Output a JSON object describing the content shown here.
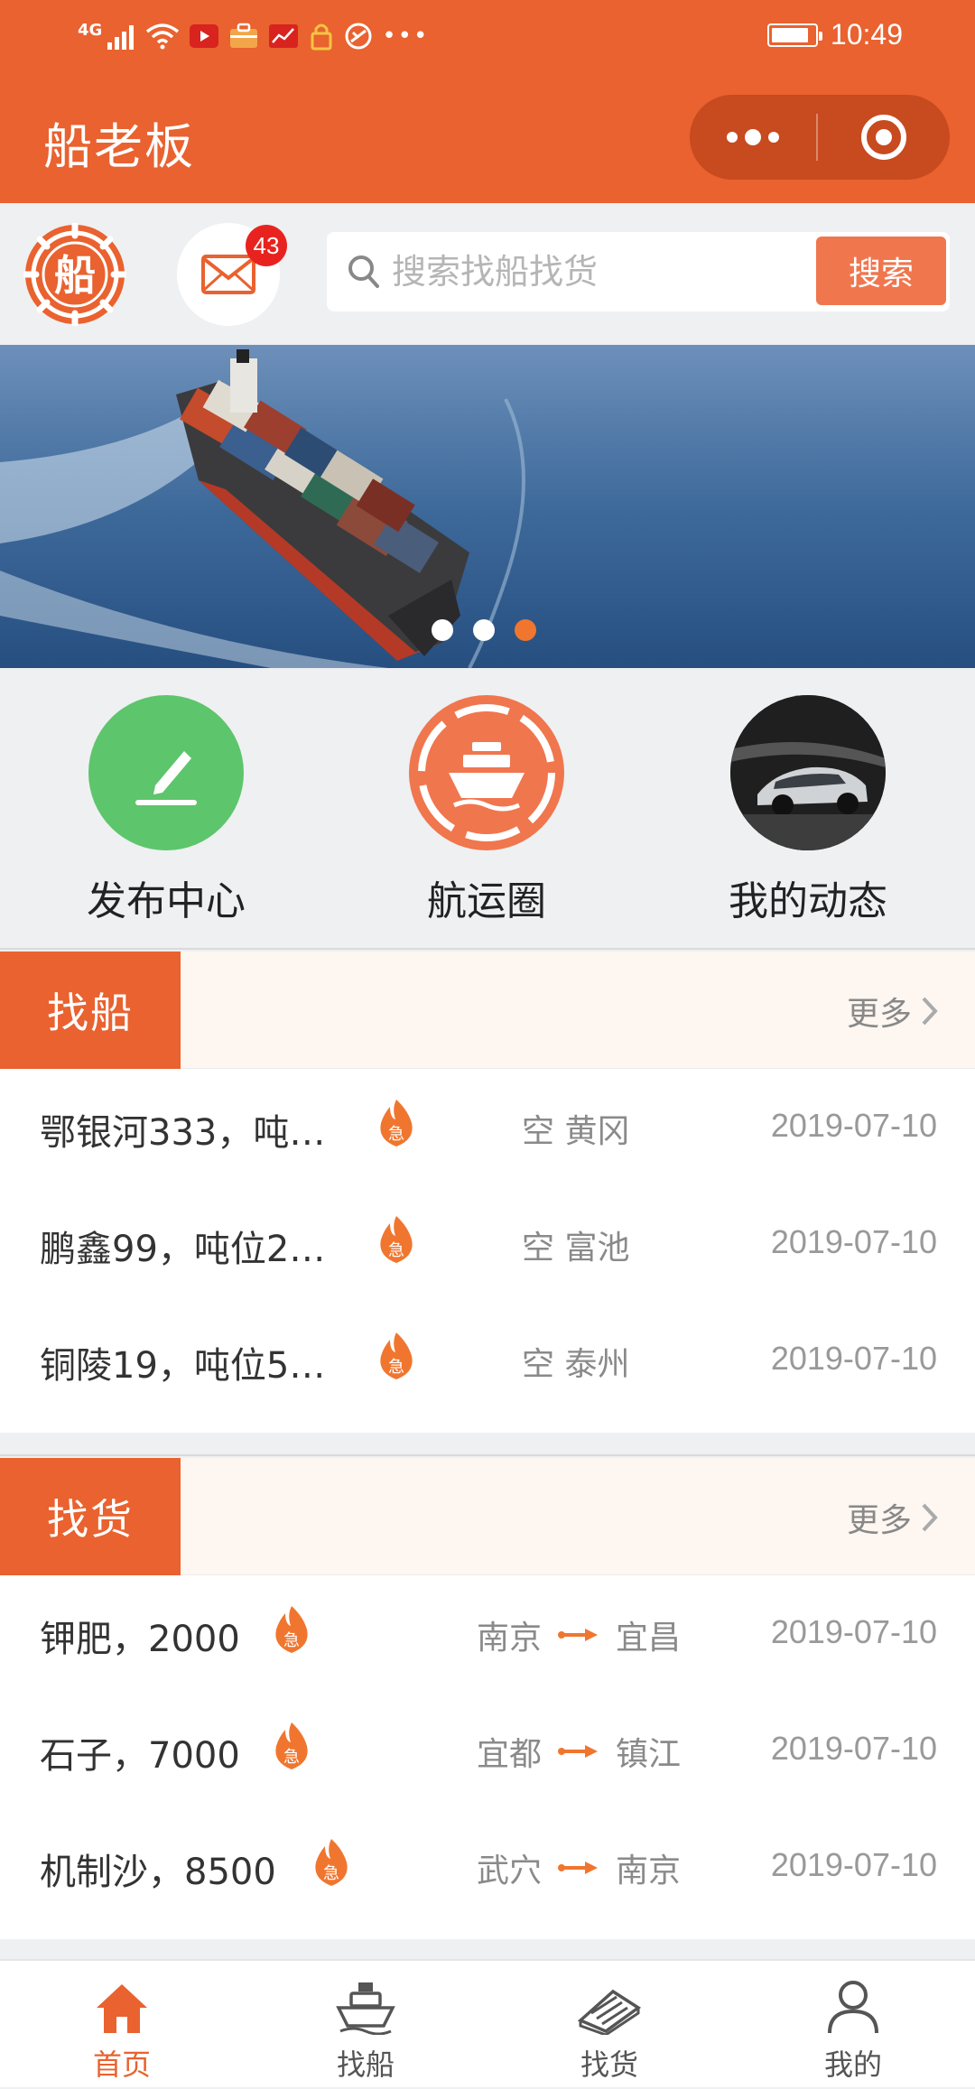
{
  "status_bar": {
    "network": "4G",
    "time": "10:49"
  },
  "header": {
    "title": "船老板"
  },
  "logo_text": "船",
  "messages": {
    "badge": "43"
  },
  "search": {
    "placeholder": "搜索找船找货",
    "button": "搜索"
  },
  "banner": {
    "slide_count": 3,
    "active_slide": 3
  },
  "quick_actions": [
    {
      "label": "发布中心",
      "icon": "pen-icon",
      "color": "#5dc56b"
    },
    {
      "label": "航运圈",
      "icon": "ship-icon",
      "color": "#f0764e"
    },
    {
      "label": "我的动态",
      "icon": "avatar-car",
      "color": "#2b2b2b"
    }
  ],
  "find_ship": {
    "tag": "找船",
    "more": "更多",
    "urgent_badge": "急",
    "rows": [
      {
        "title": "鄂银河333，吨…",
        "status": "空",
        "port": "黄冈",
        "date": "2019-07-10"
      },
      {
        "title": "鹏鑫99，吨位2…",
        "status": "空",
        "port": "富池",
        "date": "2019-07-10"
      },
      {
        "title": "铜陵19，吨位5…",
        "status": "空",
        "port": "泰州",
        "date": "2019-07-10"
      }
    ]
  },
  "find_cargo": {
    "tag": "找货",
    "more": "更多",
    "urgent_badge": "急",
    "rows": [
      {
        "title": "钾肥，2000",
        "from": "南京",
        "to": "宜昌",
        "date": "2019-07-10"
      },
      {
        "title": "石子，7000",
        "from": "宜都",
        "to": "镇江",
        "date": "2019-07-10"
      },
      {
        "title": "机制沙，8500",
        "from": "武穴",
        "to": "南京",
        "date": "2019-07-10"
      }
    ]
  },
  "tabbar": [
    {
      "label": "首页",
      "icon": "home-icon",
      "active": true
    },
    {
      "label": "找船",
      "icon": "ship-tab-icon",
      "active": false
    },
    {
      "label": "找货",
      "icon": "cargo-icon",
      "active": false
    },
    {
      "label": "我的",
      "icon": "person-icon",
      "active": false
    }
  ],
  "colors": {
    "brand": "#e9622f",
    "accent": "#f0764e",
    "badge": "#e8231f",
    "green": "#5dc56b"
  }
}
